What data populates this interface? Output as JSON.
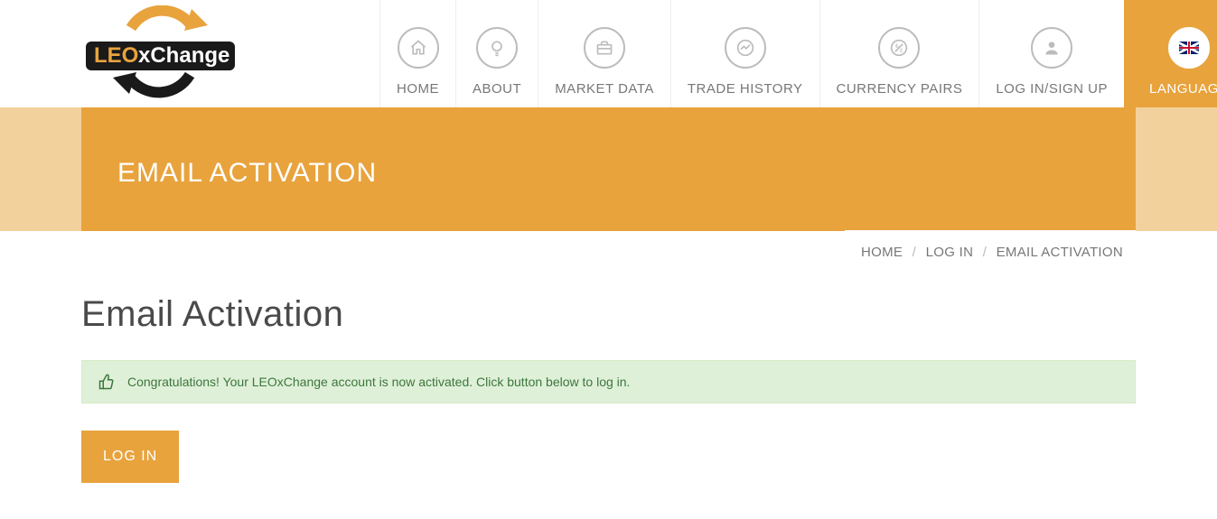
{
  "nav": {
    "home": "HOME",
    "about": "ABOUT",
    "market_data": "MARKET DATA",
    "trade_history": "TRADE HISTORY",
    "currency_pairs": "CURRENCY PAIRS",
    "login_signup": "LOG IN/SIGN UP",
    "language": "LANGUAGE"
  },
  "band": {
    "title": "EMAIL ACTIVATION"
  },
  "breadcrumb": {
    "home": "HOME",
    "login": "LOG IN",
    "current": "EMAIL ACTIVATION"
  },
  "page": {
    "heading": "Email Activation",
    "alert": "Congratulations! Your LEOxChange account is now activated. Click button below to log in.",
    "login_btn": "LOG IN"
  },
  "logo": {
    "leo": "LEO",
    "xchange": "xChange"
  }
}
